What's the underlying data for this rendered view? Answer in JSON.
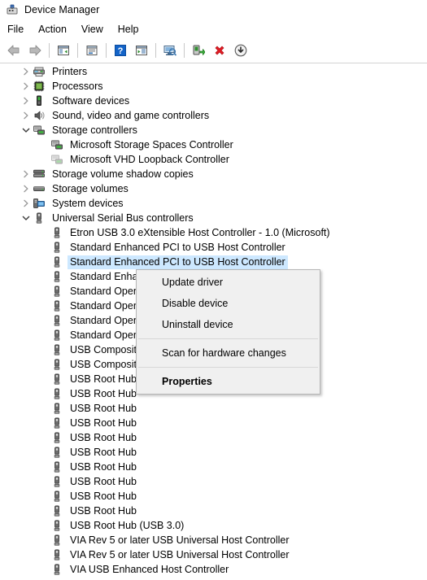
{
  "window": {
    "title": "Device Manager",
    "icon": "device-manager-icon"
  },
  "menubar": {
    "items": [
      {
        "label": "File",
        "name": "menu-file"
      },
      {
        "label": "Action",
        "name": "menu-action"
      },
      {
        "label": "View",
        "name": "menu-view"
      },
      {
        "label": "Help",
        "name": "menu-help"
      }
    ]
  },
  "toolbar": {
    "buttons": [
      {
        "icon": "back-arrow-icon",
        "name": "toolbar-back"
      },
      {
        "icon": "forward-arrow-icon",
        "name": "toolbar-forward"
      },
      {
        "icon": "separator",
        "name": "toolbar-separator-1"
      },
      {
        "icon": "show-hide-console-tree-icon",
        "name": "toolbar-show-hide-tree"
      },
      {
        "icon": "separator",
        "name": "toolbar-separator-2"
      },
      {
        "icon": "properties-icon",
        "name": "toolbar-properties"
      },
      {
        "icon": "separator",
        "name": "toolbar-separator-3"
      },
      {
        "icon": "help-icon",
        "name": "toolbar-help"
      },
      {
        "icon": "show-hide-action-pane-icon",
        "name": "toolbar-action-pane"
      },
      {
        "icon": "separator",
        "name": "toolbar-separator-4"
      },
      {
        "icon": "scan-hardware-changes-icon",
        "name": "toolbar-scan-hardware-changes"
      },
      {
        "icon": "separator",
        "name": "toolbar-separator-5"
      },
      {
        "icon": "update-driver-icon",
        "name": "toolbar-update-driver"
      },
      {
        "icon": "uninstall-device-icon",
        "name": "toolbar-uninstall-device"
      },
      {
        "icon": "disable-device-icon",
        "name": "toolbar-disable-device"
      }
    ]
  },
  "colors": {
    "selection": "#cde8ff",
    "menu_background": "#f0f0f0",
    "menu_border": "#b6b6b6",
    "window_background": "#ffffff",
    "toolbar_border": "#d4d4d4",
    "help_icon_blue": "#1464c8",
    "disable_icon_red": "#e01b24"
  },
  "tree": {
    "rows": [
      {
        "label": "Printers",
        "level": 1,
        "expander": "collapsed",
        "icon": "printer-icon",
        "selected": false,
        "name": "tree-item-printers"
      },
      {
        "label": "Processors",
        "level": 1,
        "expander": "collapsed",
        "icon": "processor-icon",
        "selected": false,
        "name": "tree-item-processors"
      },
      {
        "label": "Software devices",
        "level": 1,
        "expander": "collapsed",
        "icon": "software-device-icon",
        "selected": false,
        "name": "tree-item-software-devices"
      },
      {
        "label": "Sound, video and game controllers",
        "level": 1,
        "expander": "collapsed",
        "icon": "speaker-icon",
        "selected": false,
        "name": "tree-item-sound-video-game-controllers"
      },
      {
        "label": "Storage controllers",
        "level": 1,
        "expander": "expanded",
        "icon": "storage-controller-icon",
        "selected": false,
        "name": "tree-item-storage-controllers"
      },
      {
        "label": "Microsoft Storage Spaces Controller",
        "level": 2,
        "expander": "none",
        "icon": "storage-controller-icon",
        "selected": false,
        "name": "tree-item-microsoft-storage-spaces-controller"
      },
      {
        "label": "Microsoft VHD Loopback Controller",
        "level": 2,
        "expander": "none",
        "icon": "storage-controller-disabled-icon",
        "selected": false,
        "name": "tree-item-microsoft-vhd-loopback-controller"
      },
      {
        "label": "Storage volume shadow copies",
        "level": 1,
        "expander": "collapsed",
        "icon": "storage-volume-shadow-icon",
        "selected": false,
        "name": "tree-item-storage-volume-shadow-copies"
      },
      {
        "label": "Storage volumes",
        "level": 1,
        "expander": "collapsed",
        "icon": "storage-volume-icon",
        "selected": false,
        "name": "tree-item-storage-volumes"
      },
      {
        "label": "System devices",
        "level": 1,
        "expander": "collapsed",
        "icon": "system-device-icon",
        "selected": false,
        "name": "tree-item-system-devices"
      },
      {
        "label": "Universal Serial Bus controllers",
        "level": 1,
        "expander": "expanded",
        "icon": "usb-icon",
        "selected": false,
        "name": "tree-item-universal-serial-bus-controllers"
      },
      {
        "label": "Etron USB 3.0 eXtensible Host Controller - 1.0 (Microsoft)",
        "level": 2,
        "expander": "none",
        "icon": "usb-icon",
        "selected": false,
        "name": "tree-item-etron-usb-3-0-extensible-host-controller"
      },
      {
        "label": "Standard Enhanced PCI to USB Host Controller",
        "level": 2,
        "expander": "none",
        "icon": "usb-icon",
        "selected": false,
        "name": "tree-item-standard-enhanced-pci-to-usb-host-controller-1"
      },
      {
        "label": "Standard Enhanced PCI to USB Host Controller",
        "level": 2,
        "expander": "none",
        "icon": "usb-icon",
        "selected": true,
        "name": "tree-item-standard-enhanced-pci-to-usb-host-controller-2"
      },
      {
        "label": "Standard Enhanced PCI to USB Host Controller",
        "level": 2,
        "expander": "none",
        "icon": "usb-icon",
        "selected": false,
        "name": "tree-item-standard-enhanced-pci-to-usb-host-controller-3"
      },
      {
        "label": "Standard OpenHCD USB Host Controller",
        "level": 2,
        "expander": "none",
        "icon": "usb-icon",
        "selected": false,
        "name": "tree-item-standard-openhcd-usb-host-controller-1"
      },
      {
        "label": "Standard OpenHCD USB Host Controller",
        "level": 2,
        "expander": "none",
        "icon": "usb-icon",
        "selected": false,
        "name": "tree-item-standard-openhcd-usb-host-controller-2"
      },
      {
        "label": "Standard OpenHCD USB Host Controller",
        "level": 2,
        "expander": "none",
        "icon": "usb-icon",
        "selected": false,
        "name": "tree-item-standard-openhcd-usb-host-controller-3"
      },
      {
        "label": "Standard OpenHCD USB Host Controller",
        "level": 2,
        "expander": "none",
        "icon": "usb-icon",
        "selected": false,
        "name": "tree-item-standard-openhcd-usb-host-controller-4"
      },
      {
        "label": "USB Composite Device",
        "level": 2,
        "expander": "none",
        "icon": "usb-icon",
        "selected": false,
        "name": "tree-item-usb-composite-device-1"
      },
      {
        "label": "USB Composite Device",
        "level": 2,
        "expander": "none",
        "icon": "usb-icon",
        "selected": false,
        "name": "tree-item-usb-composite-device-2"
      },
      {
        "label": "USB Root Hub",
        "level": 2,
        "expander": "none",
        "icon": "usb-icon",
        "selected": false,
        "name": "tree-item-usb-root-hub-1"
      },
      {
        "label": "USB Root Hub",
        "level": 2,
        "expander": "none",
        "icon": "usb-icon",
        "selected": false,
        "name": "tree-item-usb-root-hub-2"
      },
      {
        "label": "USB Root Hub",
        "level": 2,
        "expander": "none",
        "icon": "usb-icon",
        "selected": false,
        "name": "tree-item-usb-root-hub-3"
      },
      {
        "label": "USB Root Hub",
        "level": 2,
        "expander": "none",
        "icon": "usb-icon",
        "selected": false,
        "name": "tree-item-usb-root-hub-4"
      },
      {
        "label": "USB Root Hub",
        "level": 2,
        "expander": "none",
        "icon": "usb-icon",
        "selected": false,
        "name": "tree-item-usb-root-hub-5"
      },
      {
        "label": "USB Root Hub",
        "level": 2,
        "expander": "none",
        "icon": "usb-icon",
        "selected": false,
        "name": "tree-item-usb-root-hub-6"
      },
      {
        "label": "USB Root Hub",
        "level": 2,
        "expander": "none",
        "icon": "usb-icon",
        "selected": false,
        "name": "tree-item-usb-root-hub-7"
      },
      {
        "label": "USB Root Hub",
        "level": 2,
        "expander": "none",
        "icon": "usb-icon",
        "selected": false,
        "name": "tree-item-usb-root-hub-8"
      },
      {
        "label": "USB Root Hub",
        "level": 2,
        "expander": "none",
        "icon": "usb-icon",
        "selected": false,
        "name": "tree-item-usb-root-hub-9"
      },
      {
        "label": "USB Root Hub",
        "level": 2,
        "expander": "none",
        "icon": "usb-icon",
        "selected": false,
        "name": "tree-item-usb-root-hub-10"
      },
      {
        "label": "USB Root Hub (USB 3.0)",
        "level": 2,
        "expander": "none",
        "icon": "usb-icon",
        "selected": false,
        "name": "tree-item-usb-root-hub-usb-3-0"
      },
      {
        "label": "VIA Rev 5 or later USB Universal Host Controller",
        "level": 2,
        "expander": "none",
        "icon": "usb-icon",
        "selected": false,
        "name": "tree-item-via-rev-5-or-later-usb-universal-host-controller-1"
      },
      {
        "label": "VIA Rev 5 or later USB Universal Host Controller",
        "level": 2,
        "expander": "none",
        "icon": "usb-icon",
        "selected": false,
        "name": "tree-item-via-rev-5-or-later-usb-universal-host-controller-2"
      },
      {
        "label": "VIA USB Enhanced Host Controller",
        "level": 2,
        "expander": "none",
        "icon": "usb-icon",
        "selected": false,
        "name": "tree-item-via-usb-enhanced-host-controller"
      }
    ]
  },
  "context_menu": {
    "items": [
      {
        "type": "item",
        "label": "Update driver",
        "bold": false,
        "name": "context-menu-update-driver"
      },
      {
        "type": "item",
        "label": "Disable device",
        "bold": false,
        "name": "context-menu-disable-device"
      },
      {
        "type": "item",
        "label": "Uninstall device",
        "bold": false,
        "name": "context-menu-uninstall-device"
      },
      {
        "type": "separator",
        "label": "",
        "bold": false,
        "name": "context-menu-separator-1"
      },
      {
        "type": "item",
        "label": "Scan for hardware changes",
        "bold": false,
        "name": "context-menu-scan-for-hardware-changes"
      },
      {
        "type": "separator",
        "label": "",
        "bold": false,
        "name": "context-menu-separator-2"
      },
      {
        "type": "item",
        "label": "Properties",
        "bold": true,
        "name": "context-menu-properties"
      }
    ]
  }
}
